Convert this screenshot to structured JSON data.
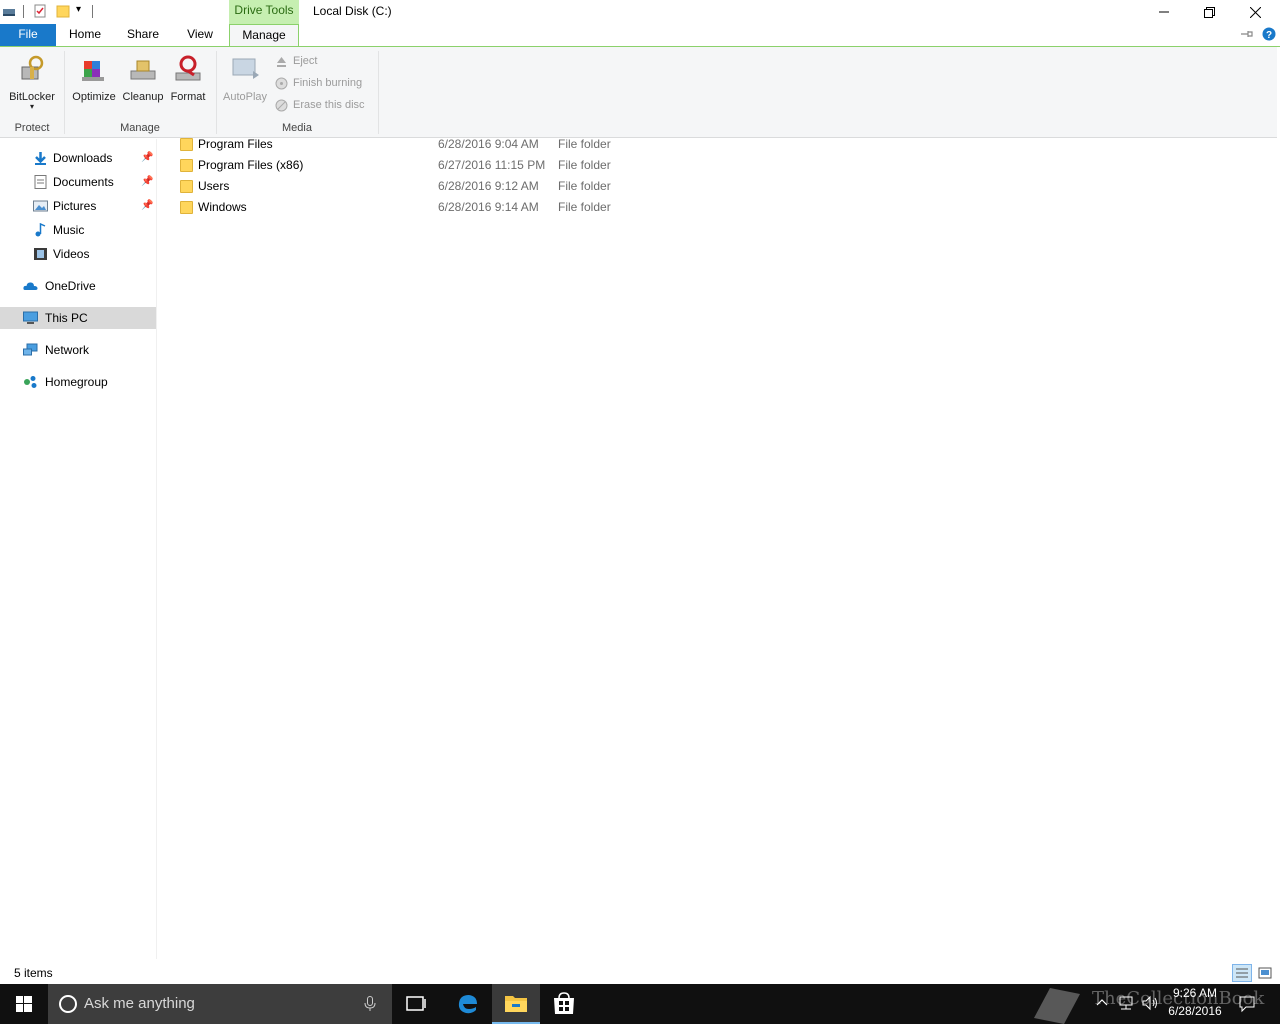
{
  "titlebar": {
    "context_tab": "Drive Tools",
    "title": "Local Disk (C:)",
    "minimize": "—",
    "restore": "❐",
    "close": "✕"
  },
  "tabs": {
    "file": "File",
    "home": "Home",
    "share": "Share",
    "view": "View",
    "manage": "Manage"
  },
  "ribbon": {
    "protect": {
      "label": "Protect",
      "bitlocker": "BitLocker"
    },
    "manage": {
      "label": "Manage",
      "optimize": "Optimize",
      "cleanup": "Cleanup",
      "format": "Format"
    },
    "media": {
      "label": "Media",
      "autoplay": "AutoPlay",
      "eject": "Eject",
      "finish_burning": "Finish burning",
      "erase_disc": "Erase this disc"
    }
  },
  "nav": {
    "items": [
      {
        "label": "Downloads",
        "pinned": true
      },
      {
        "label": "Documents",
        "pinned": true
      },
      {
        "label": "Pictures",
        "pinned": true
      },
      {
        "label": "Music"
      },
      {
        "label": "Videos"
      },
      {
        "label": "OneDrive"
      },
      {
        "label": "This PC",
        "selected": true
      },
      {
        "label": "Network"
      },
      {
        "label": "Homegroup"
      }
    ],
    "pin_glyph": "📌"
  },
  "files": [
    {
      "name": "Program Files",
      "date": "6/28/2016 9:04 AM",
      "type": "File folder"
    },
    {
      "name": "Program Files (x86)",
      "date": "6/27/2016 11:15 PM",
      "type": "File folder"
    },
    {
      "name": "Users",
      "date": "6/28/2016 9:12 AM",
      "type": "File folder"
    },
    {
      "name": "Windows",
      "date": "6/28/2016 9:14 AM",
      "type": "File folder"
    }
  ],
  "status": {
    "count": "5 items"
  },
  "taskbar": {
    "search_placeholder": "Ask me anything",
    "time": "9:26 AM",
    "date": "6/28/2016",
    "watermark": "TheCollectionBook"
  },
  "colors": {
    "accent": "#1979ca",
    "context_tab": "#c6efb1",
    "folder": "#ffd65c",
    "taskbar": "#101010"
  }
}
